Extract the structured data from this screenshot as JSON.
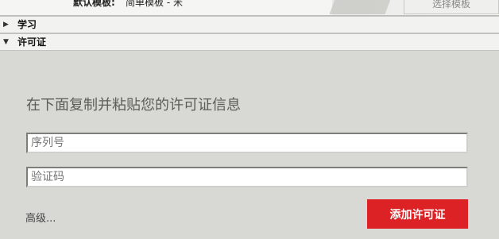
{
  "top_strip": {
    "default_template_label": "默认模板:",
    "default_template_value": "简单模板 - 米",
    "choose_template_label": "选择模板"
  },
  "sections": {
    "learn": {
      "label": "学习",
      "arrow": "▶",
      "icon": "triangle-right-icon"
    },
    "license": {
      "label": "许可证",
      "arrow": "▼",
      "icon": "triangle-down-icon"
    }
  },
  "license_panel": {
    "instruction": "在下面复制并粘贴您的许可证信息",
    "serial_field": {
      "placeholder": "序列号",
      "value": ""
    },
    "verification_field": {
      "placeholder": "验证码",
      "value": ""
    },
    "advanced_link": "高级...",
    "add_license_button": "添加许可证"
  },
  "colors": {
    "panel_bg": "#d8d8d4",
    "button_red": "#dd2226"
  }
}
